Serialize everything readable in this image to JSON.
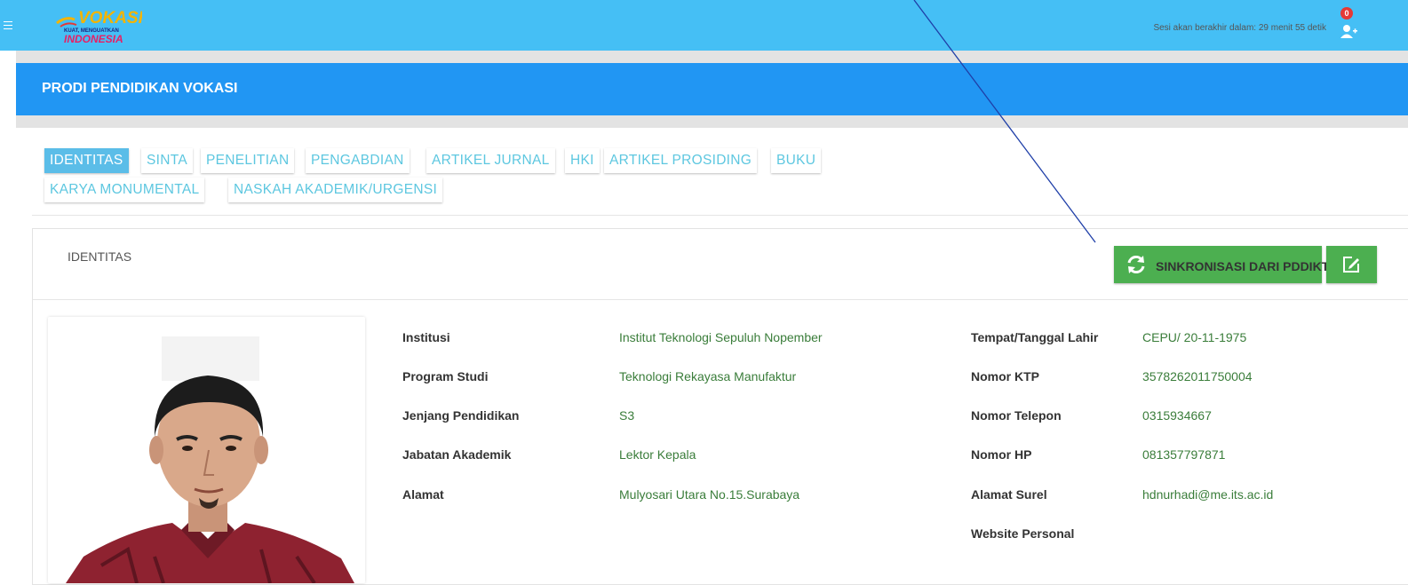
{
  "topbar": {
    "logo_text": "VOKASI KUAT, MENGUATKAN INDONESIA",
    "session_text": "Sesi akan berakhir dalam: 29 menit 55 detik",
    "notification_count": "0"
  },
  "header": {
    "title": "PRODI PENDIDIKAN VOKASI"
  },
  "tabs": [
    {
      "label": "IDENTITAS"
    },
    {
      "label": "SINTA"
    },
    {
      "label": "PENELITIAN"
    },
    {
      "label": "PENGABDIAN"
    },
    {
      "label": "ARTIKEL JURNAL"
    },
    {
      "label": "HKI"
    },
    {
      "label": "ARTIKEL PROSIDING"
    },
    {
      "label": "BUKU"
    },
    {
      "label": "KARYA MONUMENTAL"
    },
    {
      "label": "NASKAH AKADEMIK/URGENSI"
    }
  ],
  "card": {
    "title": "IDENTITAS",
    "sync_button": "SINKRONISASI DARI PDDIKTI"
  },
  "left_fields": [
    {
      "label": "Institusi",
      "value": "Institut Teknologi Sepuluh Nopember"
    },
    {
      "label": "Program Studi",
      "value": "Teknologi Rekayasa Manufaktur"
    },
    {
      "label": "Jenjang Pendidikan",
      "value": "S3"
    },
    {
      "label": "Jabatan Akademik",
      "value": "Lektor Kepala"
    },
    {
      "label": "Alamat",
      "value": "Mulyosari Utara No.15.Surabaya"
    }
  ],
  "right_fields": [
    {
      "label": "Tempat/Tanggal Lahir",
      "value": "CEPU/ 20-11-1975"
    },
    {
      "label": "Nomor KTP",
      "value": "3578262011750004"
    },
    {
      "label": "Nomor Telepon",
      "value": "0315934667"
    },
    {
      "label": "Nomor HP",
      "value": "081357797871"
    },
    {
      "label": "Alamat Surel",
      "value": "hdnurhadi@me.its.ac.id"
    },
    {
      "label": "Website Personal",
      "value": ""
    }
  ],
  "colors": {
    "topbar": "#45bff5",
    "header": "#2196f3",
    "button_green": "#4caf50",
    "value_green": "#3a7d3a"
  }
}
